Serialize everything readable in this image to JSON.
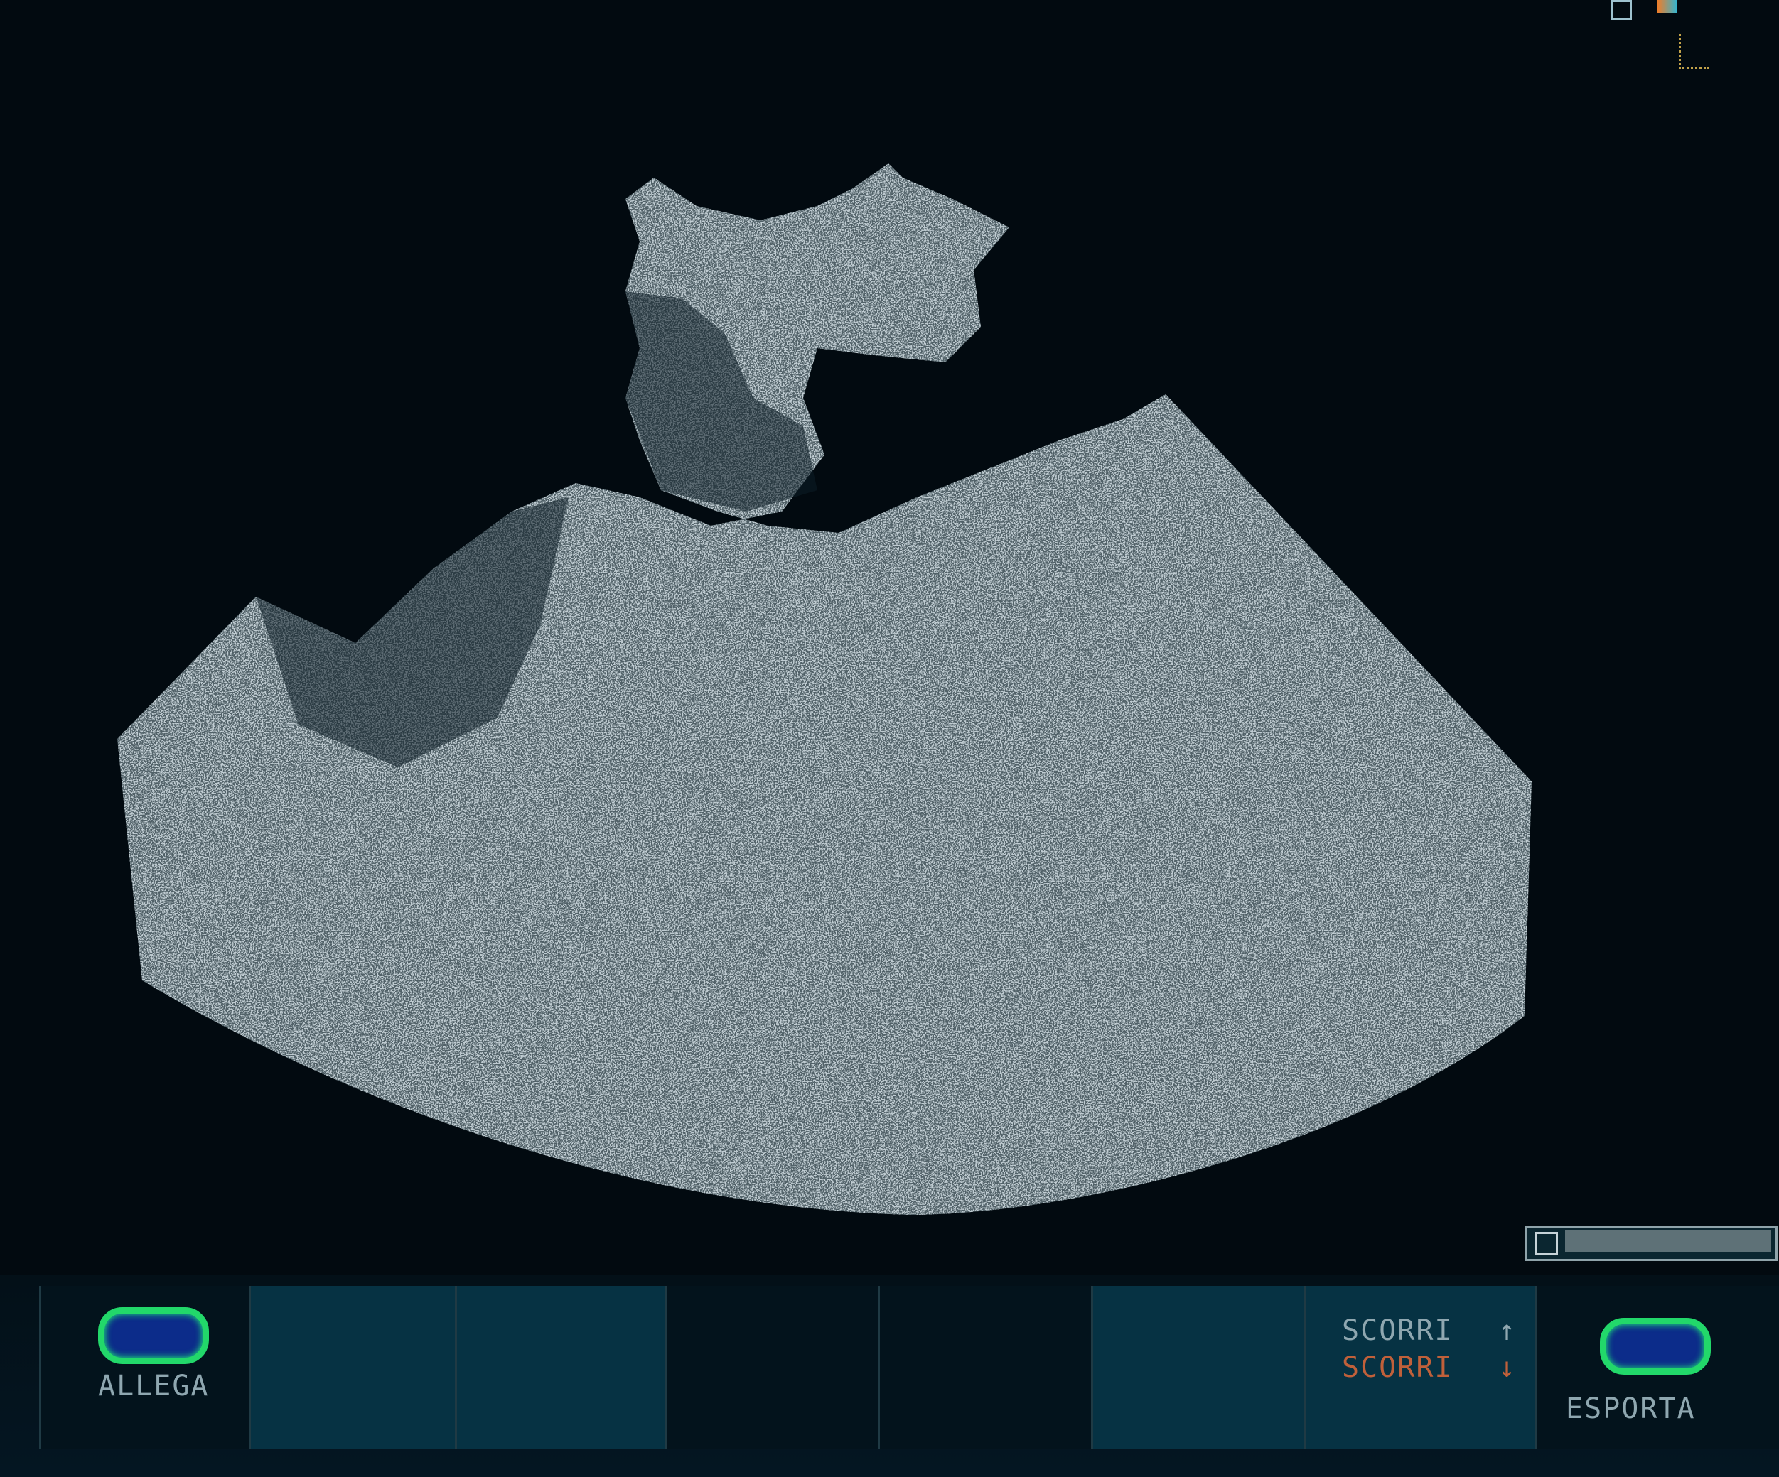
{
  "softkeys": {
    "attach_label": "ALLEGA",
    "scroll_up_label": "SCORRI",
    "scroll_down_label": "SCORRI",
    "export_label": "ESPORTA",
    "scroll_up_arrow": "↑",
    "scroll_down_arrow": "↓"
  },
  "colors": {
    "echo": "#c9d3d8",
    "accent_green": "#22d86a",
    "button_blue": "#0c2c8a",
    "scroll_down_orange": "#c0603a"
  },
  "icons": {
    "top_right": [
      "window-icon",
      "color-palette-icon",
      "probe-orientation-icon"
    ]
  }
}
